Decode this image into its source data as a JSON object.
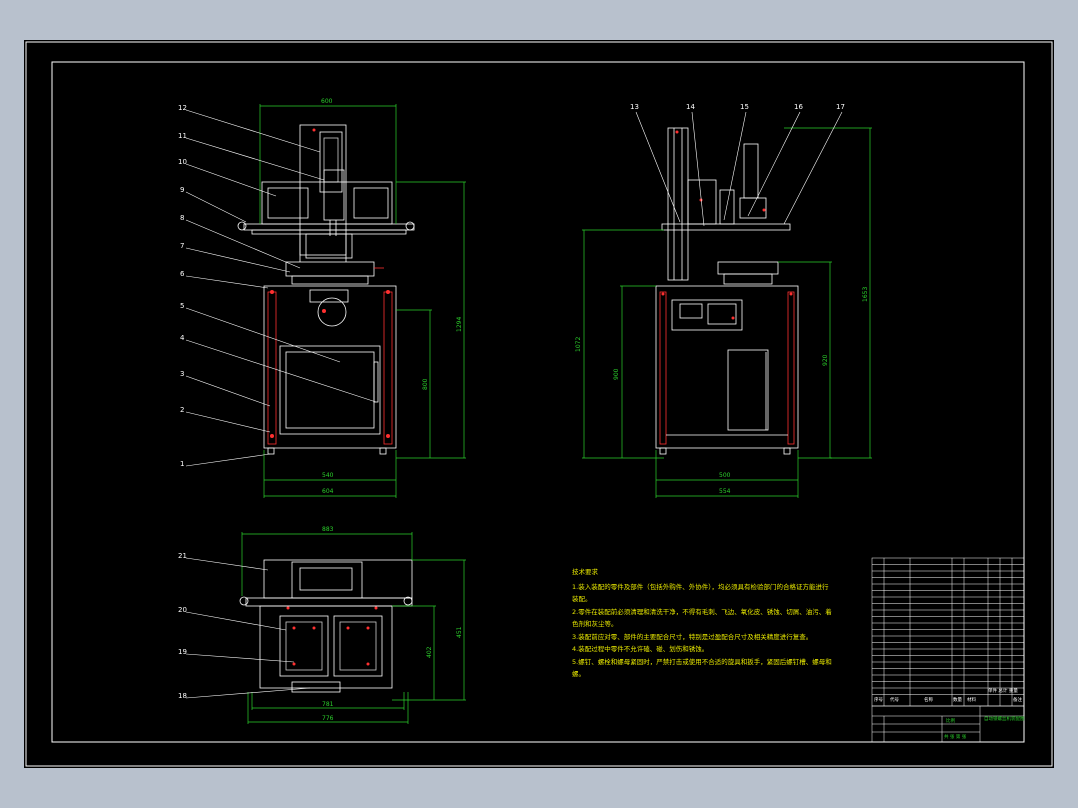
{
  "views": {
    "front": {
      "callouts": [
        "12",
        "11",
        "10",
        "9",
        "8",
        "7",
        "6",
        "5",
        "4",
        "3",
        "2",
        "1"
      ],
      "dims": {
        "top_width": "600",
        "height_total": "1294",
        "cabinet_height": "800",
        "inner_width": "540",
        "base_width": "604"
      }
    },
    "side": {
      "callouts": [
        "13",
        "14",
        "15",
        "16",
        "17"
      ],
      "dims": {
        "height_left": "1072",
        "height_mid": "900",
        "height_right": "920",
        "height_total": "1653",
        "inner_width": "500",
        "base_width": "554"
      }
    },
    "top": {
      "callouts": [
        "21",
        "20",
        "19",
        "18"
      ],
      "dims": {
        "top_width": "883",
        "depth_a": "451",
        "depth_b": "402",
        "inner_width": "781",
        "base_width": "776"
      }
    }
  },
  "notes": {
    "title": "技术要求",
    "lines": [
      "1.装入装配的零件及部件（包括外购件、外协件），均必须具有检验部门的合格证方能进行",
      "装配。",
      "2.零件在装配前必须清理和清洗干净，不得有毛刺、飞边、氧化皮、锈蚀、切屑、油污、着",
      "色剂和灰尘等。",
      "3.装配前应对零、部件的主要配合尺寸，特别是过盈配合尺寸及相关精度进行复查。",
      "4.装配过程中零件不允许磕、碰、划伤和锈蚀。",
      "5.螺钉、螺栓和螺母紧固时，严禁打击或使用不合适的旋具和扳手，紧固后螺钉槽、螺母和",
      "螺。"
    ]
  },
  "title_block": {
    "header": {
      "seq": "序号",
      "code": "代号",
      "name": "名称",
      "qty": "数量",
      "material": "材料",
      "weight": "单件 总计 重量",
      "remark": "备注"
    },
    "drawing_title": "自动锁螺丝机装配图",
    "scale_label": "比例",
    "sheet_label": "共 张 第 张"
  },
  "colors": {
    "background": "#b8c1cd",
    "sheet": "#000000",
    "line": "#ffffff",
    "dimension": "#2bd12b",
    "leader": "#ffffff",
    "accent": "#ff3030",
    "notes": "#e8e800"
  }
}
